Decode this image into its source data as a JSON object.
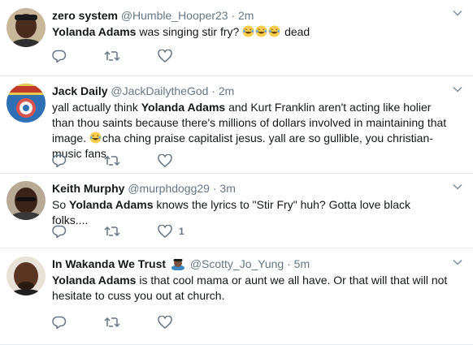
{
  "tweets": [
    {
      "name": "zero system",
      "handle": "@Humble_Hooper23",
      "dot": "·",
      "time": "2m",
      "text_bold": "Yolanda Adams",
      "text_rest": " was singing stir fry?",
      "text_tail": " dead",
      "likes": ""
    },
    {
      "name": "Jack Daily",
      "handle": "@JackDailytheGod",
      "dot": "·",
      "time": "2m",
      "text_pre": "yall actually think ",
      "text_bold": "Yolanda Adams",
      "text_rest": " and Kurt Franklin aren't acting like holier than thou saints because there's millions of dollars involved in maintaining that image.",
      "text_tail": "cha ching praise capitalist jesus. yall are so gullible, you christian-music fans.",
      "likes": ""
    },
    {
      "name": "Keith Murphy",
      "handle": "@murphdogg29",
      "dot": "·",
      "time": "3m",
      "text_pre": "So ",
      "text_bold": "Yolanda Adams",
      "text_rest": " knows the lyrics to \"Stir Fry\" huh? Gotta love black folks....",
      "likes": "1"
    },
    {
      "name": "In Wakanda We Trust",
      "handle": "@Scotty_Jo_Yung",
      "dot": "·",
      "time": "5m",
      "text_bold": "Yolanda Adams",
      "text_rest": " is that cool mama or aunt we all have. Or that will that will not hesitate to cuss you out at church.",
      "likes": ""
    }
  ],
  "colors": {
    "text": "#14171a",
    "muted": "#657786",
    "divider": "#e6ecf0"
  }
}
